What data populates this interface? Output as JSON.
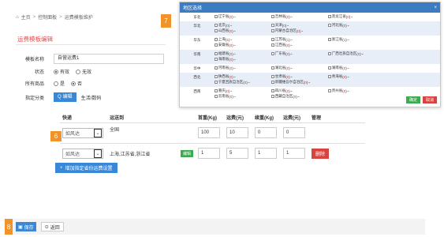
{
  "breadcrumb": {
    "items": [
      "主页",
      "控制面板",
      "运费模板维护"
    ]
  },
  "panel": {
    "title": "运费模板编辑"
  },
  "form": {
    "name_label": "模板名称",
    "name_value": "自营运费1",
    "status_label": "状态",
    "status_on": "有效",
    "status_off": "无效",
    "all_goods_label": "所有商品",
    "yes": "是",
    "no": "否",
    "category_label": "指定分类",
    "edit_button": "编辑",
    "category_value": "生活/数码"
  },
  "badges": {
    "b6": "6",
    "b7": "7",
    "b8": "8"
  },
  "table": {
    "headers": [
      "快递",
      "运送到",
      "首重(Kg)",
      "运费(元)",
      "续重(Kg)",
      "运费(元)",
      "管理"
    ],
    "rows": [
      {
        "carrier": "如风达",
        "dest": "全国",
        "first_weight": "100",
        "first_fee": "10",
        "extra_weight": "0",
        "extra_fee": "0"
      },
      {
        "carrier": "如风达",
        "dest": "上海,江苏省,浙江省",
        "edit": "编辑",
        "first_weight": "1",
        "first_fee": "5",
        "extra_weight": "1",
        "extra_fee": "1",
        "delete": "删除"
      }
    ],
    "add_button": "增加指定省份运费设置"
  },
  "bottom": {
    "save": "保存",
    "back": "返回"
  },
  "dialog": {
    "title": "地区选择",
    "ok": "确定",
    "cancel": "取消",
    "regions": [
      {
        "name": "东北",
        "provinces": [
          [
            "辽宁省",
            "0"
          ],
          [
            "吉林省",
            "0"
          ],
          [
            "黑龙江省",
            "0"
          ]
        ]
      },
      {
        "name": "华北",
        "provinces": [
          [
            "北京",
            "0"
          ],
          [
            "天津",
            "0"
          ],
          [
            "河北省",
            "0"
          ],
          [
            "山西省",
            "0"
          ],
          [
            "内蒙古自治区",
            "0"
          ]
        ]
      },
      {
        "name": "华东",
        "provinces": [
          [
            "上海",
            "1"
          ],
          [
            "江苏省",
            "1"
          ],
          [
            "浙江省",
            "1"
          ],
          [
            "安徽省",
            "0"
          ],
          [
            "江西省",
            "0"
          ]
        ]
      },
      {
        "name": "华南",
        "provinces": [
          [
            "福建省",
            "0"
          ],
          [
            "广东省",
            "0"
          ],
          [
            "广西壮族自治区",
            "0"
          ],
          [
            "海南省",
            "0"
          ]
        ]
      },
      {
        "name": "华中",
        "provinces": [
          [
            "河南省",
            "0"
          ],
          [
            "湖北省",
            "0"
          ],
          [
            "湖南省",
            "0"
          ]
        ]
      },
      {
        "name": "西北",
        "provinces": [
          [
            "陕西省",
            "0"
          ],
          [
            "甘肃省",
            "0"
          ],
          [
            "青海省",
            "0"
          ],
          [
            "宁夏回族自治区",
            "0"
          ],
          [
            "新疆维吾尔自治区",
            "0"
          ]
        ]
      },
      {
        "name": "西南",
        "provinces": [
          [
            "重庆",
            "0"
          ],
          [
            "四川省",
            "0"
          ],
          [
            "贵州省",
            "0"
          ],
          [
            "云南省",
            "0"
          ],
          [
            "西藏自治区",
            "0"
          ]
        ]
      }
    ]
  },
  "colors": {
    "accent": "#3a87d6",
    "title_red": "#e05050",
    "badge": "#f0932b",
    "dialog_head": "#3e7cc2"
  }
}
